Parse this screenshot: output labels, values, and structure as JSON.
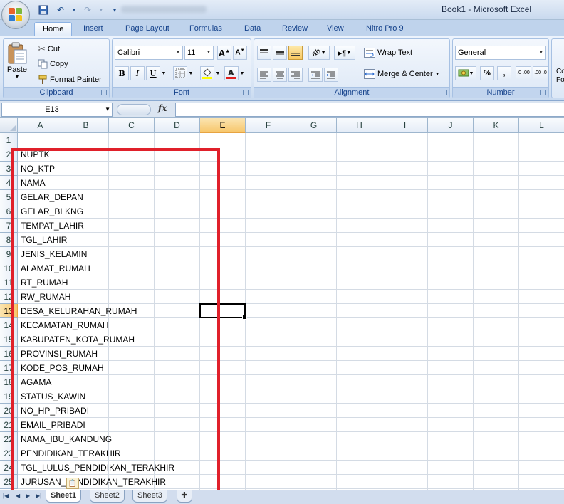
{
  "window": {
    "title": "Book1 - Microsoft Excel"
  },
  "tabs": [
    "Home",
    "Insert",
    "Page Layout",
    "Formulas",
    "Data",
    "Review",
    "View",
    "Nitro Pro 9"
  ],
  "ribbon": {
    "clipboard": {
      "label": "Clipboard",
      "paste": "Paste",
      "cut": "Cut",
      "copy": "Copy",
      "format_painter": "Format Painter"
    },
    "font": {
      "label": "Font",
      "font_name": "Calibri",
      "font_size": "11",
      "bold": "B",
      "italic": "I",
      "underline": "U"
    },
    "alignment": {
      "label": "Alignment",
      "wrap_text": "Wrap Text",
      "merge_center": "Merge & Center"
    },
    "number": {
      "label": "Number",
      "format": "General",
      "percent": "%",
      "comma": ",",
      "inc_dec": ".0 .00",
      "dec_dec": ".00 .0"
    },
    "styles_partial": {
      "line1": "Co",
      "line2": "Fo"
    }
  },
  "formula_bar": {
    "name_box": "E13",
    "fx": "fx",
    "formula": ""
  },
  "columns": [
    "A",
    "B",
    "C",
    "D",
    "E",
    "F",
    "G",
    "H",
    "I",
    "J",
    "K",
    "L"
  ],
  "selected_column": "E",
  "selected_row": "13",
  "active_cell": "E13",
  "rows": [
    {
      "n": "1",
      "a": ""
    },
    {
      "n": "2",
      "a": "NUPTK"
    },
    {
      "n": "3",
      "a": "NO_KTP"
    },
    {
      "n": "4",
      "a": "NAMA"
    },
    {
      "n": "5",
      "a": "GELAR_DEPAN"
    },
    {
      "n": "6",
      "a": "GELAR_BLKNG"
    },
    {
      "n": "7",
      "a": "TEMPAT_LAHIR"
    },
    {
      "n": "8",
      "a": "TGL_LAHIR"
    },
    {
      "n": "9",
      "a": "JENIS_KELAMIN"
    },
    {
      "n": "10",
      "a": "ALAMAT_RUMAH"
    },
    {
      "n": "11",
      "a": "RT_RUMAH"
    },
    {
      "n": "12",
      "a": "RW_RUMAH"
    },
    {
      "n": "13",
      "a": "DESA_KELURAHAN_RUMAH"
    },
    {
      "n": "14",
      "a": "KECAMATAN_RUMAH"
    },
    {
      "n": "15",
      "a": "KABUPATEN_KOTA_RUMAH"
    },
    {
      "n": "16",
      "a": "PROVINSI_RUMAH"
    },
    {
      "n": "17",
      "a": "KODE_POS_RUMAH"
    },
    {
      "n": "18",
      "a": "AGAMA"
    },
    {
      "n": "19",
      "a": "STATUS_KAWIN"
    },
    {
      "n": "20",
      "a": "NO_HP_PRIBADI"
    },
    {
      "n": "21",
      "a": "EMAIL_PRIBADI"
    },
    {
      "n": "22",
      "a": "NAMA_IBU_KANDUNG"
    },
    {
      "n": "23",
      "a": "PENDIDIKAN_TERAKHIR"
    },
    {
      "n": "24",
      "a": "TGL_LULUS_PENDIDIKAN_TERAKHIR"
    },
    {
      "n": "25",
      "a": "JURUSAN_PENDIDIKAN_TERAKHIR"
    }
  ],
  "sheets": [
    "Sheet1",
    "Sheet2",
    "Sheet3"
  ],
  "active_sheet": "Sheet1",
  "colors": {
    "highlight_box": "#e0202a",
    "selected_header": "#f7c66a",
    "ribbon_text": "#15428b"
  }
}
